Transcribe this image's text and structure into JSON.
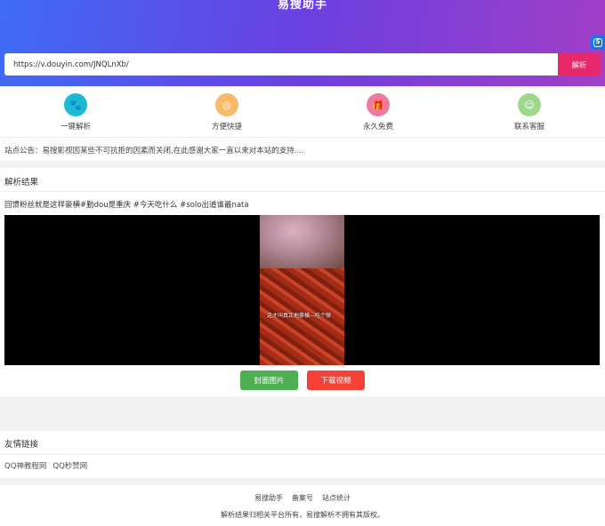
{
  "header": {
    "title": "易搜助手",
    "badge_letter": "S"
  },
  "search": {
    "value": "https://v.douyin.com/JNQLnXb/",
    "button_label": "解析"
  },
  "features": [
    {
      "label": "一键解析",
      "icon": "paw-icon",
      "color": "#1cbbd4",
      "glyph": "🐾"
    },
    {
      "label": "方便快捷",
      "icon": "compass-icon",
      "color": "#f7b96a",
      "glyph": "◎"
    },
    {
      "label": "永久免费",
      "icon": "gift-icon",
      "color": "#f07a9c",
      "glyph": "🎁"
    },
    {
      "label": "联系客服",
      "icon": "chat-icon",
      "color": "#9fd88c",
      "glyph": "☺"
    }
  ],
  "notice": "站点公告：易搜影视因某些不可抗拒的因素而关闭,在此感谢大家一直以来对本站的支持....",
  "result": {
    "title": "解析结果",
    "caption": "回馈粉丝就是这样豪横#勤dou是重庆 #今天吃什么 #solo出道谁最nata",
    "video_overlay_text": "这才叫真正地豪横—吃个够",
    "cover_button": "封面图片",
    "download_button": "下载视频"
  },
  "friend_links": {
    "title": "友情链接",
    "items": [
      "QQ神教程网",
      "QQ秒赞网"
    ]
  },
  "footer": {
    "links": [
      "易搜助手",
      "备案号",
      "站点统计"
    ],
    "copyright": "解析结果归相关平台所有，易搜解析不拥有其版权。"
  }
}
